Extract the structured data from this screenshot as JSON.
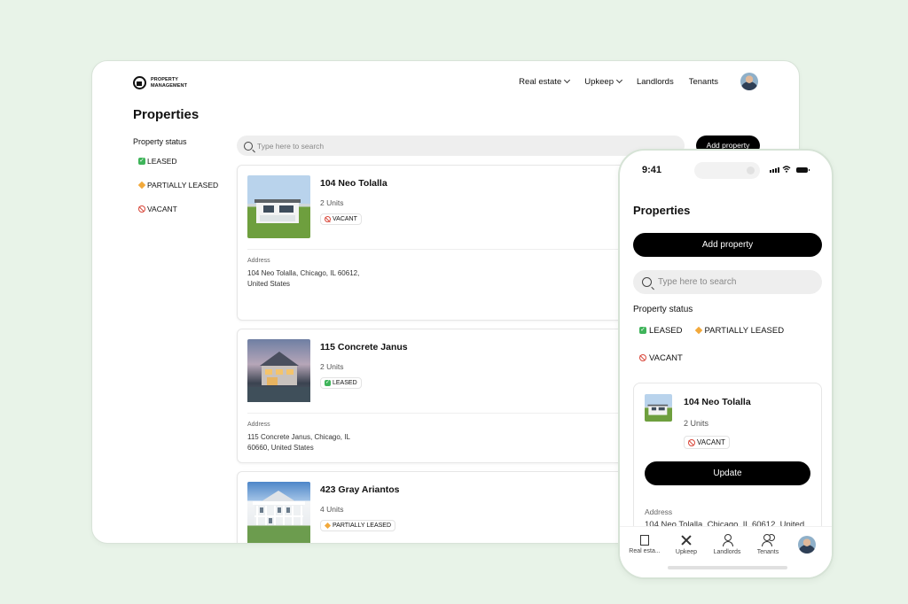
{
  "desktop": {
    "logo": {
      "line1": "PROPERTY",
      "line2": "MANAGEMENT"
    },
    "nav": [
      {
        "label": "Real estate",
        "dropdown": true
      },
      {
        "label": "Upkeep",
        "dropdown": true
      },
      {
        "label": "Landlords",
        "dropdown": false
      },
      {
        "label": "Tenants",
        "dropdown": false
      }
    ],
    "page_title": "Properties",
    "status_heading": "Property status",
    "status_filters": [
      "LEASED",
      "PARTIALLY LEASED",
      "VACANT"
    ],
    "search_placeholder": "Type here to search",
    "add_button": "Add property",
    "properties": [
      {
        "name": "104 Neo Tolalla",
        "units": "2 Units",
        "status": "VACANT",
        "address_label": "Address",
        "address": "104 Neo Tolalla, Chicago, IL 60612, United States"
      },
      {
        "name": "115 Concrete Janus",
        "units": "2 Units",
        "status": "LEASED",
        "address_label": "Address",
        "address": "115 Concrete Janus, Chicago, IL 60660, United States"
      },
      {
        "name": "423 Gray Ariantos",
        "units": "4 Units",
        "status": "PARTIALLY LEASED"
      }
    ]
  },
  "phone": {
    "time": "9:41",
    "title": "Properties",
    "add_button": "Add property",
    "search_placeholder": "Type here to search",
    "status_heading": "Property status",
    "status_filters": [
      "LEASED",
      "PARTIALLY LEASED",
      "VACANT"
    ],
    "card": {
      "name": "104 Neo Tolalla",
      "units": "2 Units",
      "status": "VACANT",
      "update_button": "Update",
      "address_label": "Address",
      "address": "104 Neo Tolalla, Chicago, IL 60612, United"
    },
    "tabs": [
      "Real esta...",
      "Upkeep",
      "Landlords",
      "Tenants"
    ]
  },
  "colors": {
    "background": "#e8f3e8",
    "primary_button": "#000000",
    "leased": "#3fb45a",
    "partial": "#f2a93b",
    "vacant": "#d9493c"
  }
}
